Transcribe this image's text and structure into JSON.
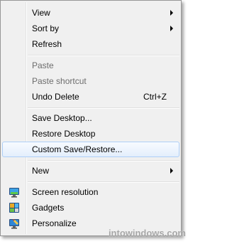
{
  "menu": {
    "items": [
      {
        "label": "View",
        "submenu": true
      },
      {
        "label": "Sort by",
        "submenu": true
      },
      {
        "label": "Refresh"
      },
      {
        "label": "Paste",
        "disabled": true
      },
      {
        "label": "Paste shortcut",
        "disabled": true
      },
      {
        "label": "Undo Delete",
        "shortcut": "Ctrl+Z"
      },
      {
        "label": "Save Desktop..."
      },
      {
        "label": "Restore Desktop"
      },
      {
        "label": "Custom Save/Restore...",
        "highlighted": true
      },
      {
        "label": "New",
        "submenu": true
      },
      {
        "label": "Screen resolution",
        "icon": "monitor-icon"
      },
      {
        "label": "Gadgets",
        "icon": "gadgets-icon"
      },
      {
        "label": "Personalize",
        "icon": "personalize-icon"
      }
    ]
  },
  "watermark": "intowindows.com",
  "colors": {
    "menu_bg": "#f0f0f0",
    "highlight_border": "#aecff7",
    "disabled_text": "#6d6d6d"
  }
}
